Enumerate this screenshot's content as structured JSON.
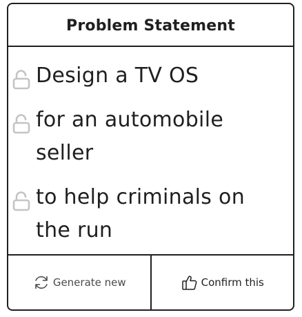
{
  "card": {
    "title": "Problem Statement",
    "lines": [
      {
        "text": "Design a TV OS",
        "locked": false,
        "icon": "unlocked-padlock-icon"
      },
      {
        "text": "for an automobile seller",
        "locked": false,
        "icon": "unlocked-padlock-icon"
      },
      {
        "text": "to help criminals on the run",
        "locked": false,
        "icon": "unlocked-padlock-icon"
      }
    ]
  },
  "footer": {
    "generate_label": "Generate new",
    "generate_icon": "refresh-icon",
    "confirm_label": "Confirm this",
    "confirm_icon": "thumbs-up-icon"
  },
  "colors": {
    "border": "#1f1f1f",
    "lock": "#c4c4c4",
    "secondary_text": "#4a4a4a"
  }
}
